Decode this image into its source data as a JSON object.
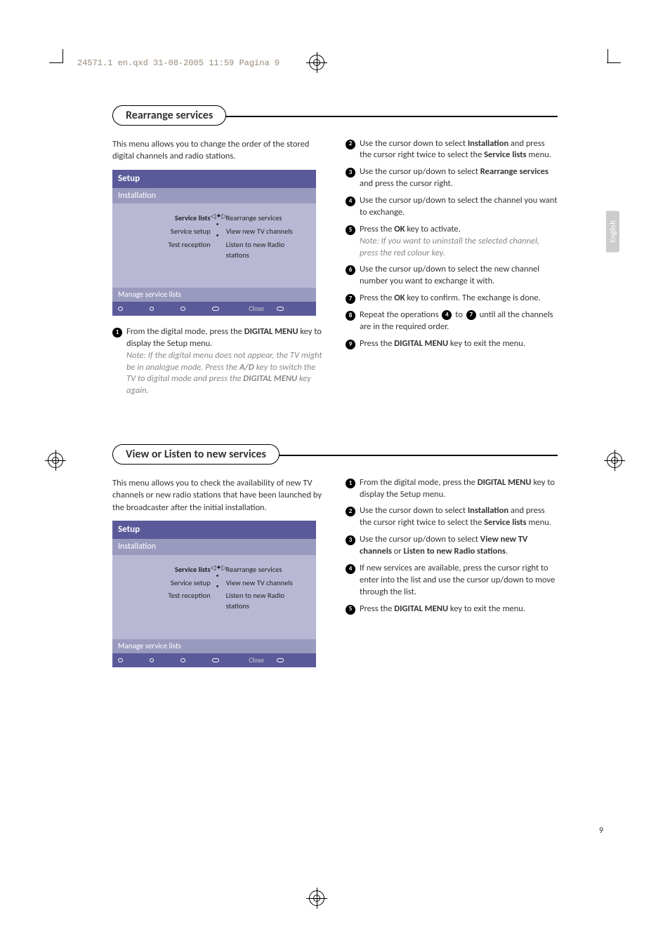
{
  "header_line": "24571.1 en.qxd  31-08-2005  11:59  Pagina 9",
  "lang_tab": "English",
  "page_number": "9",
  "section1": {
    "title": "Rearrange services",
    "intro": "This menu allows you to change the order of the stored digital channels and radio stations.",
    "setup": {
      "title": "Setup",
      "subtitle": "Installation",
      "left": {
        "item1": "Service lists",
        "item2": "Service setup",
        "item3": "Test reception"
      },
      "right": {
        "item1": "Rearrange services",
        "item2": "View new TV channels",
        "item3": "Listen to new Radio stations"
      },
      "footer1": "Manage service lists",
      "close": "Close"
    },
    "left_steps": {
      "s1_a": "From the digital mode, press the ",
      "s1_b": "DIGITAL MENU",
      "s1_c": " key to display the Setup menu.",
      "s1_note_a": "Note: If the digital menu does not appear, the TV might be in analogue mode. Press the ",
      "s1_note_b": "A/D",
      "s1_note_c": " key to switch the TV to digital mode and press the ",
      "s1_note_d": "DIGITAL MENU",
      "s1_note_e": " key again."
    },
    "right_steps": {
      "s2_a": "Use the cursor down to select ",
      "s2_b": "Installation",
      "s2_c": " and press the cursor right twice to select the ",
      "s2_d": "Service lists",
      "s2_e": " menu.",
      "s3_a": "Use the cursor up/down to select ",
      "s3_b": "Rearrange services",
      "s3_c": " and press the cursor right.",
      "s4": "Use the cursor up/down to select the channel you want to exchange.",
      "s5_a": "Press the ",
      "s5_b": "OK",
      "s5_c": " key to activate.",
      "s5_note": "Note: If you want to uninstall the selected channel, press the red colour key.",
      "s6": "Use the cursor up/down to select the new channel number you want to exchange it with.",
      "s7_a": "Press the ",
      "s7_b": "OK",
      "s7_c": " key to confirm. The exchange is done.",
      "s8_a": "Repeat the operations ",
      "s8_b": " to ",
      "s8_c": " until all the channels are in the required order.",
      "s9_a": "Press the ",
      "s9_b": "DIGITAL MENU",
      "s9_c": " key to exit the menu."
    }
  },
  "section2": {
    "title": "View or Listen to new services",
    "intro": "This menu allows you to check the availability of new TV channels or new radio stations that have been launched by the broadcaster after the initial installation.",
    "setup": {
      "title": "Setup",
      "subtitle": "Installation",
      "left": {
        "item1": "Service lists",
        "item2": "Service setup",
        "item3": "Test reception"
      },
      "right": {
        "item1": "Rearrange services",
        "item2": "View new TV channels",
        "item3": "Listen to new Radio stations"
      },
      "footer1": "Manage service lists",
      "close": "Close"
    },
    "right_steps": {
      "s1_a": "From the digital mode, press the ",
      "s1_b": "DIGITAL MENU",
      "s1_c": " key to display the Setup menu.",
      "s2_a": "Use the cursor down to select ",
      "s2_b": "Installation",
      "s2_c": " and press the cursor right twice to select the ",
      "s2_d": "Service lists",
      "s2_e": " menu.",
      "s3_a": "Use the cursor up/down to select ",
      "s3_b": "View new TV channels",
      "s3_c": " or ",
      "s3_d": "Listen to new Radio stations",
      "s3_e": ".",
      "s4": "If new services are available, press the cursor right to enter into the list and use the cursor up/down to move through the list.",
      "s5_a": "Press the ",
      "s5_b": "DIGITAL MENU",
      "s5_c": " key to exit the menu."
    }
  }
}
